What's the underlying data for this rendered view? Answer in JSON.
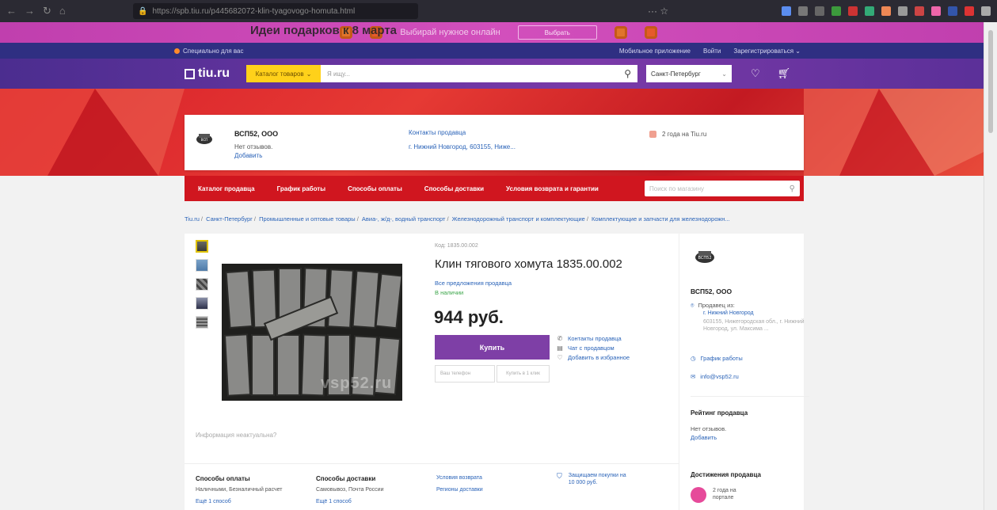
{
  "browser": {
    "url": "https://spb.tiu.ru/p445682072-klin-tyagovogo-homuta.html",
    "actions": "···  ☆"
  },
  "promo": {
    "title": "Идеи подарков к 8 марта",
    "subtitle": "Выбирай нужное онлайн",
    "button": "Выбрать"
  },
  "top_strip": {
    "special": "Специально для вас",
    "mobile_app": "Мобильное приложение",
    "login": "Войти",
    "register": "Зарегистрироваться"
  },
  "header": {
    "logo": "tiu.ru",
    "catalog": "Каталог товаров",
    "search_placeholder": "Я ищу...",
    "city": "Санкт-Петербург"
  },
  "seller": {
    "name": "ВСП52, ООО",
    "reviews": "Нет отзывов.",
    "add_review": "Добавить",
    "contacts": "Контакты продавца",
    "address": "г. Нижний Новгород, 603155, Ниже...",
    "years": "2 года на Tiu.ru"
  },
  "seller_menu": {
    "items": [
      "Каталог продавца",
      "График работы",
      "Способы оплаты",
      "Способы доставки",
      "Условия возврата и гарантии"
    ],
    "search_placeholder": "Поиск по магазину"
  },
  "breadcrumb": [
    "Tiu.ru",
    "Санкт-Петербург",
    "Промышленные и оптовые товары",
    "Авиа-, ж/д-, водный транспорт",
    "Железнодорожный транспорт и комплектующие",
    "Комплектующие и запчасти для железнодорожн..."
  ],
  "product": {
    "code": "Код: 1835.00.002",
    "title": "Клин тягового хомута 1835.00.002",
    "all_offers": "Все предложения продавца",
    "in_stock": "В наличии",
    "price": "944 руб.",
    "buy": "Купить",
    "phone_placeholder": "Ваш телефон",
    "one_click": "Купить в 1 клик",
    "links": {
      "contacts": "Контакты продавца",
      "chat": "Чат с продавцом",
      "favorite": "Добавить в избранное"
    },
    "watermark": "vsp52.ru",
    "inaccurate": "Информация неактуальна?"
  },
  "sidebar": {
    "name": "ВСП52, ООО",
    "seller_from": "Продавец из:",
    "city": "г. Нижний Новгород",
    "address": "603155, Нижегородская обл., г. Нижний Новгород, ул. Максима ...",
    "schedule": "График работы",
    "email": "info@vsp52.ru",
    "rating_title": "Рейтинг продавца",
    "rating_none": "Нет отзывов.",
    "rating_add": "Добавить",
    "achievements_title": "Достижения продавца",
    "achievement": "2 года на портале"
  },
  "bottom": {
    "payment_title": "Способы оплаты",
    "payment_text": "Наличными, Безналичный расчет",
    "payment_more": "Ещё 1 способ",
    "delivery_title": "Способы доставки",
    "delivery_text": "Самовывоз, Почта России",
    "delivery_more": "Ещё 1 способ",
    "return": "Условия возврата",
    "regions": "Регионы доставки",
    "guarantee": "Защищаем покупки на 10 000 руб."
  },
  "colors": {
    "accent_purple": "#7e3fa6",
    "menu_red": "#d0161f",
    "link": "#2a63b8",
    "stock_green": "#3aa548"
  }
}
